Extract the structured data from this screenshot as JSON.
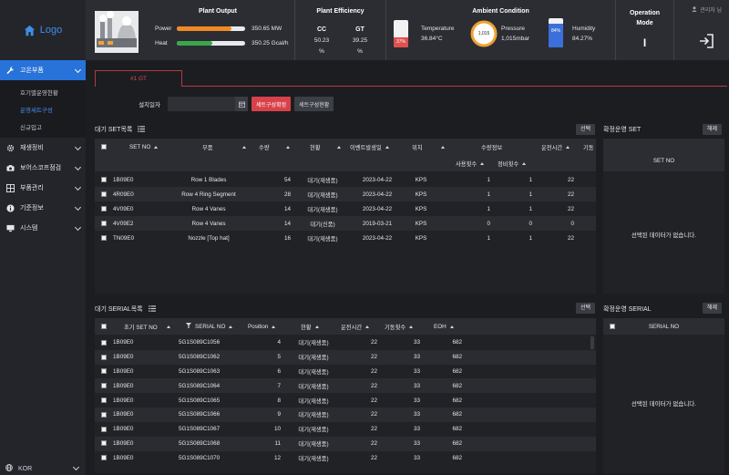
{
  "sidebar": {
    "logo": "Logo",
    "items": [
      {
        "label": "고온부품",
        "icon": "wrench-icon",
        "active": true
      },
      {
        "label": "재생정비",
        "icon": "gear-icon"
      },
      {
        "label": "보어스코프점검",
        "icon": "camera-icon"
      },
      {
        "label": "부품관리",
        "icon": "grid-icon"
      },
      {
        "label": "기준정보",
        "icon": "info-icon"
      },
      {
        "label": "시스템",
        "icon": "monitor-icon"
      }
    ],
    "submenu": [
      "호기별운영현황",
      "운영세트구성",
      "신규입고"
    ],
    "language": "KOR"
  },
  "header": {
    "plant_output": {
      "title": "Plant Output",
      "power_label": "Power",
      "power_value": "350.65 MW",
      "power_fill": 0.8,
      "heat_label": "Heat",
      "heat_value": "350.25 Gcal/h",
      "heat_fill": 0.52
    },
    "plant_efficiency": {
      "title": "Plant Efficiency",
      "cc_label": "CC",
      "gt_label": "GT",
      "cc_value": "50.23",
      "gt_value": "39.25",
      "cc_unit": "%",
      "gt_unit": "%"
    },
    "ambient": {
      "title": "Ambient Condition",
      "temp_label": "Temperature",
      "temp_value": "36.84°C",
      "temp_badge": "37%",
      "pressure_label": "Pressure",
      "pressure_value": "1,015mbar",
      "pressure_badge": "1,015",
      "humidity_label": "Humidity",
      "humidity_value": "84.27%",
      "humidity_badge": "84%"
    },
    "operation_mode": {
      "title_line1": "Operation",
      "title_line2": "Mode",
      "value": "I"
    },
    "user_label": "관리자 님",
    "colors": {
      "power": "#f08a24",
      "heat": "#3aa64a",
      "temp": "#e05050",
      "pressure": "#f0a030",
      "humidity": "#3b6fd9"
    }
  },
  "tabs": [
    "#1 GT"
  ],
  "filter": {
    "label": "설치일자",
    "date_value": "",
    "btn_primary": "세트구성확정",
    "btn_secondary": "세트구성현황"
  },
  "wait_set": {
    "title": "대기 SET목록",
    "select_btn": "선택",
    "columns": [
      "SET NO",
      "부품",
      "수량",
      "현황",
      "이벤트발생일",
      "위치",
      "수량정보",
      "운전시간",
      "기동"
    ],
    "sub_columns": [
      "사용횟수",
      "정비횟수"
    ],
    "rows": [
      [
        "1B09E0",
        "Row 1 Blades",
        "54",
        "대기(재생품)",
        "2023-04-22",
        "KPS",
        "1",
        "1",
        "22"
      ],
      [
        "4R09E0",
        "Row 4 Ring Segment",
        "28",
        "대기(재생품)",
        "2023-04-22",
        "KPS",
        "1",
        "1",
        "22"
      ],
      [
        "4V09E0",
        "Row 4 Vanes",
        "14",
        "대기(재생품)",
        "2023-04-22",
        "KPS",
        "1",
        "1",
        "22"
      ],
      [
        "4V09E2",
        "Row 4 Vanes",
        "14",
        "대기(신품)",
        "2019-03-21",
        "KPS",
        "0",
        "0",
        "0"
      ],
      [
        "TN09E0",
        "Nozzle [Top hat]",
        "16",
        "대기(재생품)",
        "2023-04-22",
        "KPS",
        "1",
        "1",
        "22"
      ]
    ]
  },
  "confirmed_set": {
    "title": "확정운영 SET",
    "remove_btn": "해제",
    "column": "SET NO",
    "empty": "선택된 데이터가 없습니다."
  },
  "wait_serial": {
    "title": "대기 SERIAL목록",
    "select_btn": "선택",
    "columns": [
      "초기 SET NO",
      "SERIAL NO",
      "Position",
      "현황",
      "운전시간",
      "기동횟수",
      "EOH"
    ],
    "rows": [
      [
        "1B09E0",
        "5G1S089C1056",
        "4",
        "대기(재생품)",
        "22",
        "33",
        "682"
      ],
      [
        "1B09E0",
        "5G1S089C1062",
        "5",
        "대기(재생품)",
        "22",
        "33",
        "682"
      ],
      [
        "1B09E0",
        "5G1S089C1063",
        "6",
        "대기(재생품)",
        "22",
        "33",
        "682"
      ],
      [
        "1B09E0",
        "5G1S089C1064",
        "7",
        "대기(재생품)",
        "22",
        "33",
        "682"
      ],
      [
        "1B09E0",
        "5G1S089C1065",
        "8",
        "대기(재생품)",
        "22",
        "33",
        "682"
      ],
      [
        "1B09E0",
        "5G1S089C1066",
        "9",
        "대기(재생품)",
        "22",
        "33",
        "682"
      ],
      [
        "1B09E0",
        "5G1S089C1067",
        "10",
        "대기(재생품)",
        "22",
        "33",
        "682"
      ],
      [
        "1B09E0",
        "5G1S089C1068",
        "11",
        "대기(재생품)",
        "22",
        "33",
        "682"
      ],
      [
        "1B09E0",
        "5G1S089C1070",
        "12",
        "대기(재생품)",
        "22",
        "33",
        "682"
      ]
    ]
  },
  "confirmed_serial": {
    "title": "확정운영 SERIAL",
    "remove_btn": "해제",
    "column": "SERIAL NO",
    "empty": "선택된 데이터가 없습니다."
  }
}
